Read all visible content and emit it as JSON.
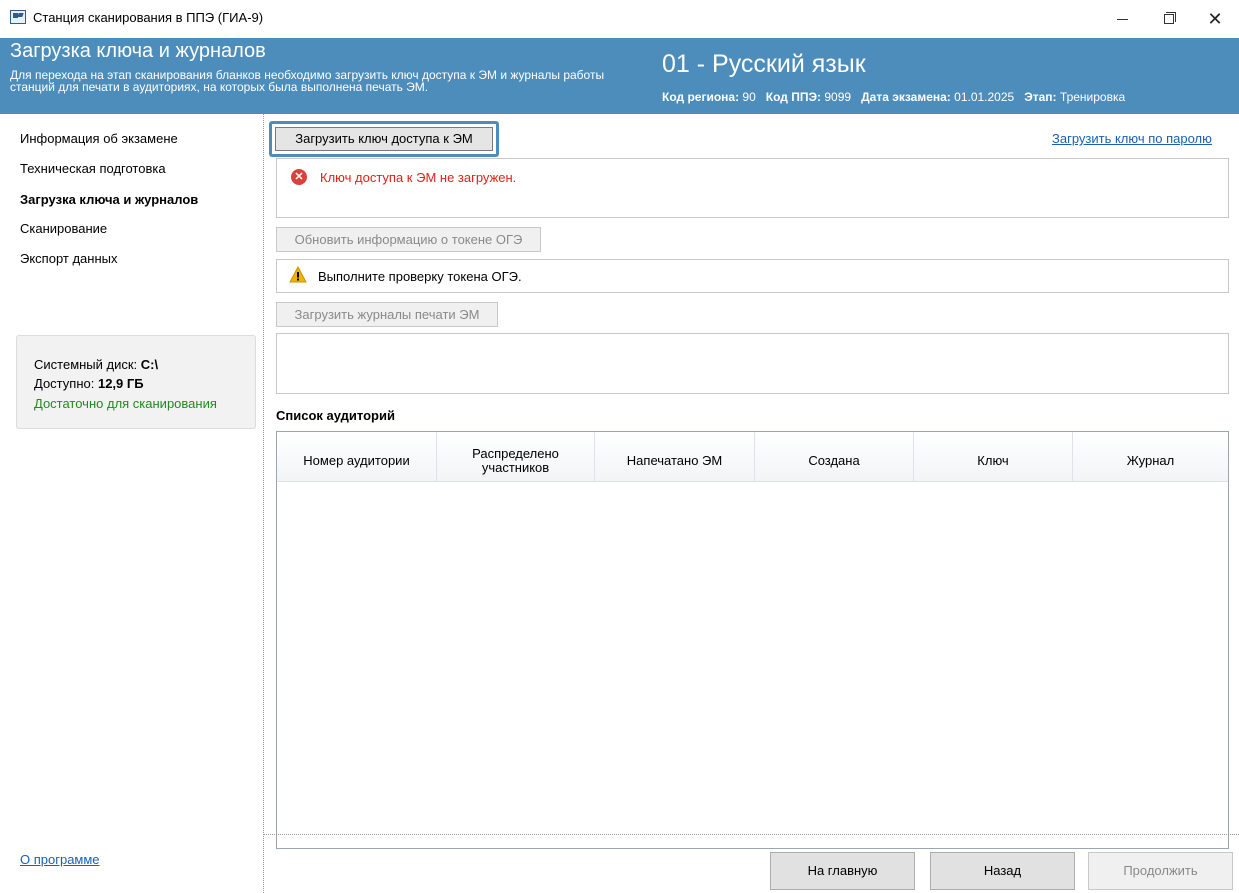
{
  "window": {
    "title": "Станция сканирования в ППЭ (ГИА-9)",
    "controls": {
      "minimize": "—",
      "maximize": "❐",
      "close": "✕"
    }
  },
  "header": {
    "title": "Загрузка ключа и журналов",
    "description": "Для перехода на этап сканирования бланков необходимо загрузить ключ доступа к ЭМ и журналы работы станций для печати в аудиториях, на которых была выполнена печать ЭМ.",
    "subject": "01 - Русский язык",
    "region_label": "Код региона:",
    "region_value": "90",
    "ppe_label": "Код ППЭ:",
    "ppe_value": "9099",
    "date_label": "Дата экзамена:",
    "date_value": "01.01.2025",
    "stage_label": "Этап:",
    "stage_value": "Тренировка"
  },
  "sidebar": {
    "items": [
      {
        "label": "Информация об экзамене",
        "active": false
      },
      {
        "label": "Техническая подготовка",
        "active": false
      },
      {
        "label": "Загрузка ключа и журналов",
        "active": true
      },
      {
        "label": "Сканирование",
        "active": false
      },
      {
        "label": "Экспорт данных",
        "active": false
      }
    ],
    "disk": {
      "system_label": "Системный диск:",
      "system_value": "C:\\",
      "free_label": "Доступно:",
      "free_value": "12,9 ГБ",
      "status": "Достаточно для сканирования"
    },
    "about_link": "О программе"
  },
  "main": {
    "load_key_button": "Загрузить ключ доступа к ЭМ",
    "load_by_password_link": "Загрузить ключ по паролю",
    "key_error": "Ключ доступа к ЭМ не загружен.",
    "refresh_token_button": "Обновить информацию о токене ОГЭ",
    "token_warning": "Выполните проверку токена ОГЭ.",
    "load_journals_button": "Загрузить журналы печати ЭМ",
    "journals_message": "",
    "rooms_title": "Список аудиторий",
    "table": {
      "columns": [
        "Номер аудитории",
        "Распределено участников",
        "Напечатано ЭМ",
        "Создана",
        "Ключ",
        "Журнал"
      ],
      "rows": []
    }
  },
  "footer": {
    "home_button": "На главную",
    "back_button": "Назад",
    "continue_button": "Продолжить"
  },
  "colors": {
    "header_bg": "#4d8dbb",
    "error_text": "#e0201a",
    "ok_text": "#1f8b1f",
    "link": "#1a5fb4"
  }
}
